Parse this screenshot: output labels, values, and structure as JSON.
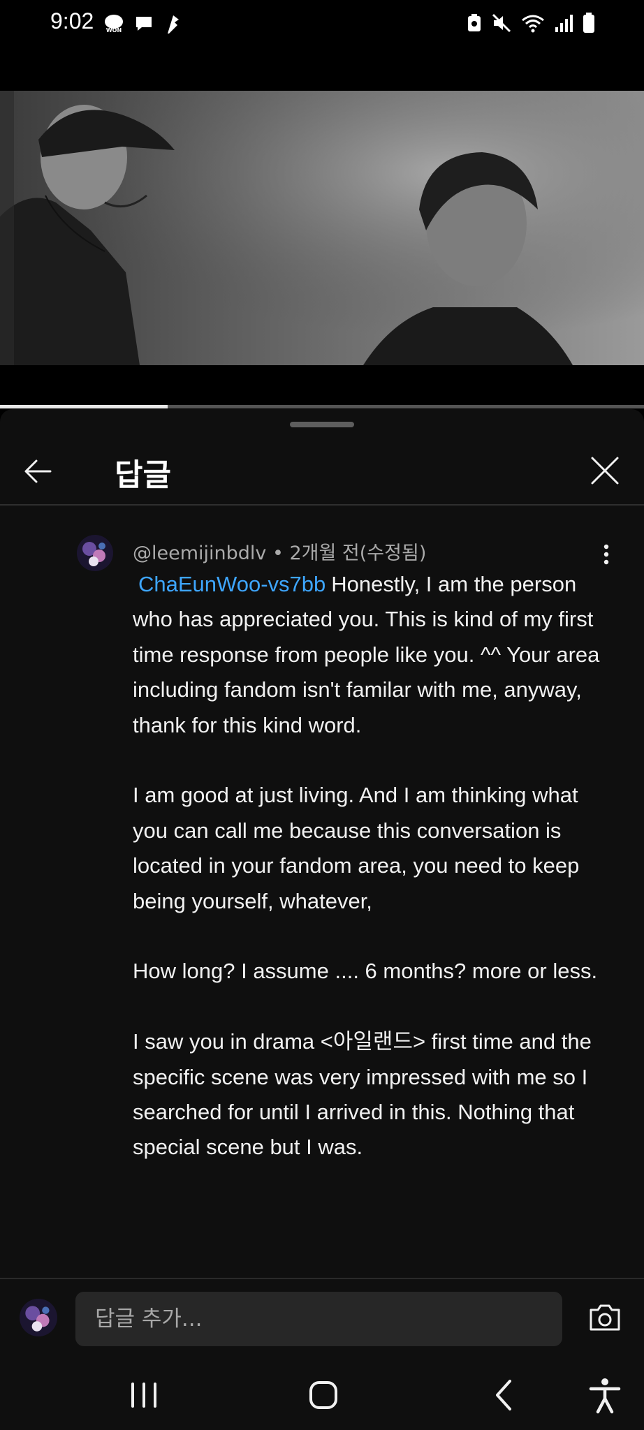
{
  "status_bar": {
    "time": "9:02",
    "left_icons": [
      "won-icon",
      "chat-bubble-icon",
      "app-notification-icon"
    ],
    "right_icons": [
      "battery-saver-icon",
      "mute-icon",
      "wifi-icon",
      "signal-icon",
      "battery-icon"
    ]
  },
  "video": {
    "progress_fraction": 0.26
  },
  "sheet": {
    "title": "답글",
    "back_icon": "arrow-left-icon",
    "close_icon": "close-icon"
  },
  "comment": {
    "meta": "@leemijinbdlv • 2개월 전(수정됨)",
    "mention": "ChaEunWoo-vs7bb",
    "first_paragraph": "Honestly, I am the person who has appreciated you. This is kind of my first time response from people like you. ^^ Your area including fandom isn't familar with me, anyway, thank for this kind word.",
    "paragraphs": [
      "I am good at just living. And I am thinking what you can call me because this conversation is located in your fandom area, you need to keep being yourself, whatever,",
      "How long? I assume .... 6 months? more or less.",
      "I saw you in drama <아일랜드> first time and the specific scene was very impressed with me so I searched for until I arrived in this. Nothing that special scene but I was."
    ]
  },
  "reply_bar": {
    "placeholder": "답글 추가..."
  },
  "nav_bar": {
    "icons": [
      "recent-apps-icon",
      "home-icon",
      "back-icon",
      "accessibility-icon"
    ]
  },
  "colors": {
    "mention": "#3ea6ff",
    "sheet_bg": "#0f0f0f",
    "input_bg": "#272727"
  }
}
